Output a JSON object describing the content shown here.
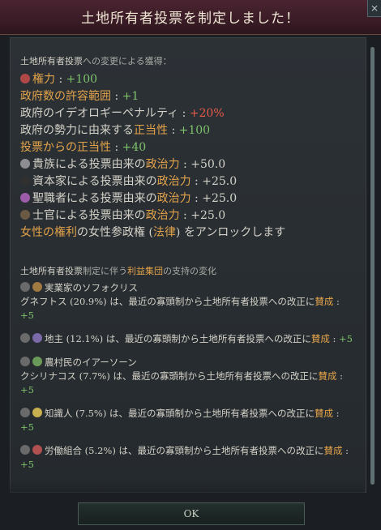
{
  "header": {
    "title": "土地所有者投票を制定しました！",
    "close_icon": "×"
  },
  "sections": {
    "gains_header_bold": "土地所有者投票",
    "gains_header_rest": "への変更による獲得：",
    "ig_header_bold": "土地所有者投票",
    "ig_header_mid": "制定に伴う",
    "ig_header_link": "利益集団",
    "ig_header_rest": "の支持の変化"
  },
  "effects": [
    {
      "label": "権力",
      "value": "+100"
    },
    {
      "label": "政府数の許容範囲",
      "value": "+1"
    },
    {
      "label": "政府のイデオロギーペナルティ",
      "value": "+20%"
    },
    {
      "label_a": "政府の勢力に由来する",
      "label_b": "正当性",
      "value": "+100"
    },
    {
      "label_a": "投票からの",
      "label_b": "正当性",
      "value": "+40"
    },
    {
      "label_a": "貴族による投票由来の",
      "label_b": "政治力",
      "value": "+50.0"
    },
    {
      "label_a": "資本家による投票由来の",
      "label_b": "政治力",
      "value": "+25.0"
    },
    {
      "label_a": "聖職者による投票由来の",
      "label_b": "政治力",
      "value": "+25.0"
    },
    {
      "label_a": "士官による投票由来の",
      "label_b": "政治力",
      "value": "+25.0"
    },
    {
      "label_a": "女性の権利",
      "label_b": "の女性参政権",
      "label_c": "法律",
      "label_d": "をアンロックします"
    }
  ],
  "interest_groups": [
    {
      "name": "実業家のソフォクリス",
      "line": "グネフトス (20.9%) は、最近の寡頭制から土地所有者投票への改正に",
      "verdict": "賛成",
      "value": "+5"
    },
    {
      "name": "",
      "line": "地主 (12.1%) は、最近の寡頭制から土地所有者投票への改正に",
      "verdict": "賛成",
      "value": "+5"
    },
    {
      "name": "農村民のイアーソーン",
      "line": "クシリナコス (7.7%) は、最近の寡頭制から土地所有者投票への改正に",
      "verdict": "賛成",
      "value": "+5"
    },
    {
      "name": "",
      "line": "知識人 (7.5%) は、最近の寡頭制から土地所有者投票への改正に",
      "verdict": "賛成",
      "value": "+5"
    },
    {
      "name": "",
      "line": "労働組合 (5.2%) は、最近の寡頭制から土地所有者投票への改正に",
      "verdict": "賛成",
      "value": "+5"
    }
  ],
  "footer": {
    "ok_label": "OK"
  }
}
